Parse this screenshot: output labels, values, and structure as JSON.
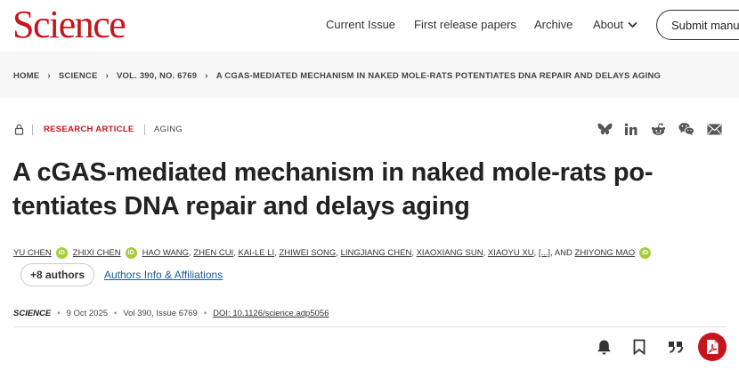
{
  "header": {
    "logo": "Science",
    "nav": [
      "Current Issue",
      "First release papers",
      "Archive",
      "About"
    ],
    "submit_label": "Submit manus"
  },
  "breadcrumb": [
    "HOME",
    "SCIENCE",
    "VOL. 390, NO. 6769",
    "A CGAS-MEDIATED MECHANISM IN NAKED MOLE-RATS POTENTIATES DNA REPAIR AND DELAYS AGING"
  ],
  "article": {
    "type": "RESEARCH ARTICLE",
    "subject": "AGING",
    "title": "A cGAS-mediated mechanism in naked mole-rats po- tentiates DNA repair and delays aging",
    "authors": [
      "YU CHEN",
      "ZHIXI CHEN",
      "HAO WANG",
      "ZHEN CUI",
      "KAI-LE LI",
      "ZHIWEI SONG",
      "LINGJIANG CHEN",
      "XIAOXIANG SUN",
      "XIAOYU XU",
      "[...]",
      "ZHIYONG MAO"
    ],
    "author_and": ", AND",
    "more_authors_label": "+8 authors",
    "affiliations_label": "Authors Info & Affiliations",
    "journal": "SCIENCE",
    "date": "9 Oct 2025",
    "issue": "Vol 390, Issue 6769",
    "doi": "DOI: 10.1126/science.adp5056"
  },
  "icons": {
    "orcid_label": "iD",
    "share": [
      "bluesky-icon",
      "linkedin-icon",
      "reddit-icon",
      "wechat-icon",
      "email-icon"
    ],
    "tools": [
      "bell-icon",
      "bookmark-icon",
      "quote-icon",
      "pdf-icon"
    ]
  },
  "colors": {
    "brand": "#c4161c",
    "link": "#1a5b9e",
    "orcid": "#a6ce39"
  }
}
